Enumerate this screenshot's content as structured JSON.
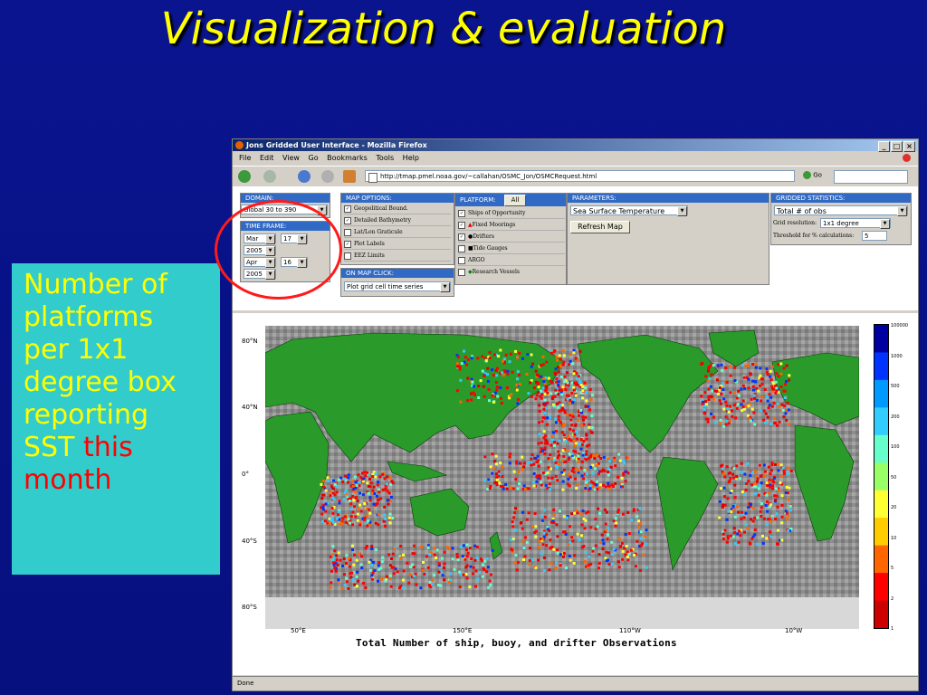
{
  "slide": {
    "title": "Visualization & evaluation",
    "callout_lines": [
      "Number of",
      "platforms",
      "per 1x1",
      "degree box",
      "reporting"
    ],
    "callout_last_prefix": "SST ",
    "callout_last_highlight": "this",
    "callout_final": "month",
    "colors": {
      "background": "#08118a",
      "title": "#ffff00",
      "callout_bg": "#33cccc",
      "highlight": "#ff0000"
    }
  },
  "browser": {
    "window_title": "Jons Gridded User Interface - Mozilla Firefox",
    "menu": [
      "File",
      "Edit",
      "View",
      "Go",
      "Bookmarks",
      "Tools",
      "Help"
    ],
    "url": "http://tmap.pmel.noaa.gov/~callahan/OSMC_Jon/OSMCRequest.html",
    "go_label": "Go",
    "status": "Done"
  },
  "form": {
    "domain": {
      "header": "DOMAIN:",
      "value": "Global 30 to 390"
    },
    "time_frame": {
      "header": "TIME FRAME:",
      "start_month": "Mar",
      "start_day": "17",
      "start_year": "2005",
      "end_month": "Apr",
      "end_day": "16",
      "end_year": "2005"
    },
    "map_options": {
      "header": "MAP OPTIONS:",
      "items": [
        {
          "label": "Geopolitical Bound.",
          "checked": true
        },
        {
          "label": "Detailed Bathymetry",
          "checked": true
        },
        {
          "label": "Lat/Lon Graticule",
          "checked": false
        },
        {
          "label": "Plot Labels",
          "checked": true
        },
        {
          "label": "EEZ Limits",
          "checked": false
        }
      ]
    },
    "on_map_click": {
      "header": "ON MAP CLICK:",
      "value": "Plot grid cell time series"
    },
    "platform": {
      "header": "PLATFORM:",
      "all_button": "All",
      "items": [
        {
          "label": "Ships of Opportunity",
          "checked": true
        },
        {
          "label": "Fixed Moorings",
          "checked": true
        },
        {
          "label": "Drifters",
          "checked": true
        },
        {
          "label": "Tide Gauges",
          "checked": false
        },
        {
          "label": "ARGO",
          "checked": false
        },
        {
          "label": "Research Vessels",
          "checked": false
        }
      ]
    },
    "parameters": {
      "header": "PARAMETERS:",
      "value": "Sea Surface Temperature",
      "refresh": "Refresh Map"
    },
    "gridded_stats": {
      "header": "GRIDDED STATISTICS:",
      "value": "Total # of obs",
      "grid_label": "Grid resolution:",
      "grid_value": "1x1 degree",
      "threshold_label": "Threshold for % calculations:",
      "threshold_value": "5"
    }
  },
  "map": {
    "title": "Total Number of ship, buoy, and drifter Observations",
    "lat_labels": [
      "80°N",
      "40°N",
      "0°",
      "40°S",
      "80°S"
    ],
    "lon_labels": [
      "50°E",
      "150°E",
      "110°W",
      "10°W"
    ],
    "colorbar_labels": [
      "100000",
      "1000",
      "500",
      "200",
      "100",
      "50",
      "20",
      "10",
      "5",
      "2",
      "1"
    ],
    "colorbar_colors": [
      "#0000a0",
      "#0033ff",
      "#0099ff",
      "#33ccff",
      "#66ffcc",
      "#99ff66",
      "#ffff33",
      "#ffcc00",
      "#ff6600",
      "#ff0000",
      "#cc0000"
    ]
  }
}
